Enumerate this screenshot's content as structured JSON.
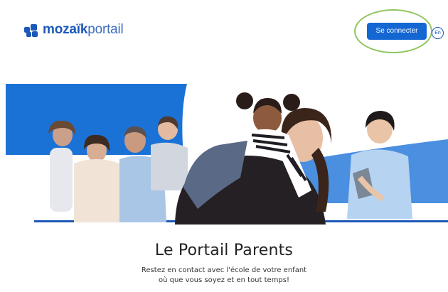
{
  "header": {
    "logo": {
      "brand_bold": "mozaïk",
      "brand_light": "portail"
    },
    "connect_label": "Se connecter",
    "language_label": "En"
  },
  "hero": {
    "image": "photo-banner-families-and-children",
    "colors": {
      "blue": "#1b72d6",
      "light_blue": "#4a8fe0",
      "underline": "#1c58b8"
    }
  },
  "main": {
    "title": "Le Portail Parents",
    "subtitle_line1": "Restez en contact avec l'école de votre enfant",
    "subtitle_line2": "où que vous soyez et en tout temps!"
  },
  "colors": {
    "brand": "#1c58b8",
    "button": "#1467d3",
    "highlight_ring": "#8fc55e"
  }
}
